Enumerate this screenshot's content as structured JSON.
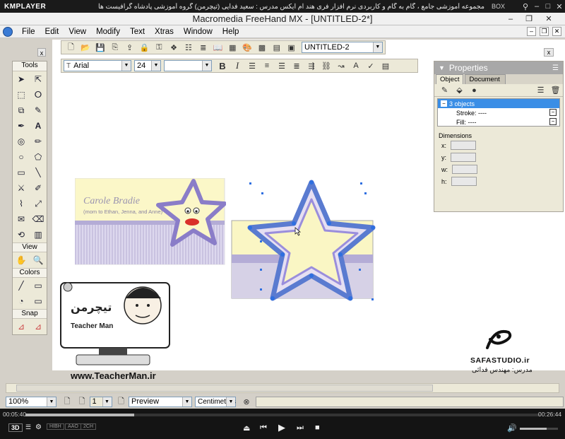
{
  "player": {
    "logo": "KMPLAYER",
    "caption": "مجموعه آموزشی جامع ، گام به گام و کاربردی نرم افزار فری هند ام ایکس   مدرس : سعید فدایی (تیچرمن) گروه آموزشی پادشاه گرافیست ها",
    "box_label": "BOX",
    "elapsed": "00:05:40",
    "total": "00:26:44",
    "progress": 0.212,
    "volume": 0.7,
    "badges": [
      "3D",
      "HIBH",
      "AAO",
      "2CH"
    ]
  },
  "app": {
    "title": "Macromedia FreeHand MX - [UNTITLED-2*]",
    "menu": [
      "File",
      "Edit",
      "View",
      "Modify",
      "Text",
      "Xtras",
      "Window",
      "Help"
    ]
  },
  "toolbar": {
    "document_select": "UNTITLED-2",
    "font": "Arial",
    "size": "24",
    "style": ""
  },
  "tools_panel": {
    "title": "Tools",
    "view_label": "View",
    "colors_label": "Colors",
    "snap_label": "Snap",
    "close_label": "x"
  },
  "properties": {
    "title": "Properties",
    "tabs": [
      "Object",
      "Document"
    ],
    "items": [
      {
        "label": "3 objects",
        "box": "−"
      },
      {
        "label": "Stroke: ----",
        "box": "−"
      },
      {
        "label": "Fill: ----",
        "box": "−"
      }
    ],
    "dimensions_label": "Dimensions",
    "dims": [
      "x:",
      "y:",
      "w:",
      "h:"
    ]
  },
  "card": {
    "name": "Carole Bradie",
    "sub": "(mom to Ethan, Jenna, and Anne)",
    "card_color": "#fbf7c8",
    "stripe_color": "#c9c2e0",
    "star_fill": "#fbf7c8",
    "star_stroke": "#8a7dc8"
  },
  "watermark": {
    "teacherman_url": "www.TeacherMan.ir",
    "teacherman_name": "Teacher Man",
    "teacherman_brand": "تیچرمن",
    "safa": "SAFASTUDIO.ir",
    "safa_teacher": "مدرس: مهندس فدائی"
  },
  "status": {
    "zoom": "100%",
    "page": "1",
    "mode": "Preview",
    "units": "Centimeters"
  }
}
